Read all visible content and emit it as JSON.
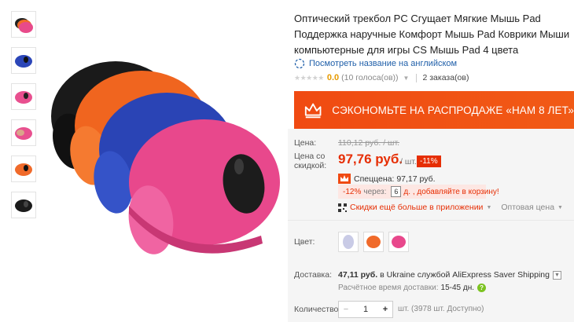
{
  "product": {
    "title": "Оптический трекбол PC Сгущает Мягкие Мышь Pad Поддержка наручные Комфорт Мышь Pad Коврики Мыши компьютерные для игры CS Мышь Pad 4 цвета",
    "view_english": "Посмотреть название на английском",
    "rating_value": "0.0",
    "votes": "(10 голоса(ов))",
    "orders": "2 заказа(ов)"
  },
  "banner": {
    "text": "СЭКОНОМЬТЕ НА РАСПРОДАЖЕ «НАМ 8 ЛЕТ»",
    "color": "#f15a16"
  },
  "price": {
    "label": "Цена:",
    "old": "110,12 руб. / шт.",
    "discount_label": "Цена со скидкой:",
    "current": "97,76 руб.",
    "unit": "/ шт.",
    "discount_badge": "-11%",
    "special": "Спеццена: 97,17 руб.",
    "promo_percent": "-12%",
    "promo_via": "через:",
    "promo_qty": "6",
    "promo_tail": "д. , добавляйте в корзину!",
    "app_text": "Скидки ещё больше в приложении",
    "wholesale": "Оптовая цена"
  },
  "color": {
    "label": "Цвет:",
    "options": [
      "light-grey",
      "orange",
      "pink"
    ]
  },
  "shipping": {
    "label": "Доставка:",
    "price": "47,11 руб.",
    "method": "в Ukraine службой AliExpress Saver Shipping",
    "time_label": "Расчётное время доставки:",
    "time_value": "15-45 дн."
  },
  "quantity": {
    "label": "Количество:",
    "value": "1",
    "available": "шт. (3978 шт. Доступно)"
  },
  "accent_color": "#e62e04",
  "icons": [
    "globe-icon",
    "crown-icon",
    "qr-code-icon",
    "help-icon",
    "chevron-down-icon"
  ]
}
